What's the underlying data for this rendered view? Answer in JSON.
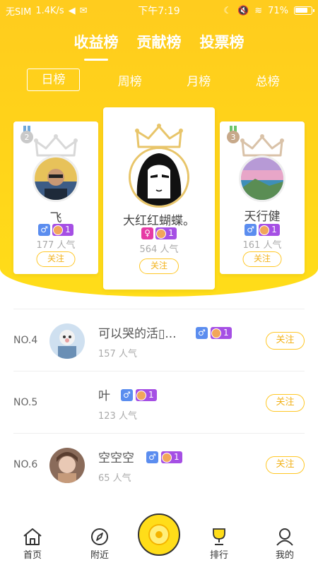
{
  "status_bar": {
    "carrier": "无SIM",
    "speed": "1.4K/s",
    "time": "下午7:19",
    "battery": "71%"
  },
  "main_tabs": [
    {
      "label": "收益榜",
      "active": true
    },
    {
      "label": "贡献榜",
      "active": false
    },
    {
      "label": "投票榜",
      "active": false
    }
  ],
  "sub_tabs": [
    {
      "label": "日榜",
      "active": true
    },
    {
      "label": "周榜",
      "active": false
    },
    {
      "label": "月榜",
      "active": false
    },
    {
      "label": "总榜",
      "active": false
    }
  ],
  "podium": {
    "first": {
      "name": "大红红蝴蝶。",
      "sex": "♀",
      "level": "1",
      "popularity": "564 人气",
      "follow": "关注"
    },
    "second": {
      "rank_badge": "2",
      "name": "飞",
      "sex": "♂",
      "level": "1",
      "popularity": "177 人气",
      "follow": "关注"
    },
    "third": {
      "rank_badge": "3",
      "name": "天行健",
      "sex": "♂",
      "level": "1",
      "popularity": "161 人气",
      "follow": "关注"
    }
  },
  "list": [
    {
      "rank": "NO.4",
      "name": "可以哭的活▯...",
      "sex": "♂",
      "level": "1",
      "popularity": "157 人气",
      "follow": "关注"
    },
    {
      "rank": "NO.5",
      "name": "叶",
      "sex": "♂",
      "level": "1",
      "popularity": "123 人气",
      "follow": "关注"
    },
    {
      "rank": "NO.6",
      "name": "空空空",
      "sex": "♂",
      "level": "1",
      "popularity": "65 人气",
      "follow": "关注"
    }
  ],
  "bottom_nav": [
    {
      "label": "首页",
      "icon": "home-icon"
    },
    {
      "label": "附近",
      "icon": "compass-icon"
    },
    {
      "label": "",
      "icon": "record-icon"
    },
    {
      "label": "排行",
      "icon": "trophy-icon"
    },
    {
      "label": "我的",
      "icon": "profile-icon"
    }
  ],
  "colors": {
    "header_yellow": "#FFD21A",
    "follow_border": "#FFC726",
    "male_badge": "#5B8DEF",
    "female_badge": "#E63AA5",
    "level_badge": "#A54FE4"
  }
}
